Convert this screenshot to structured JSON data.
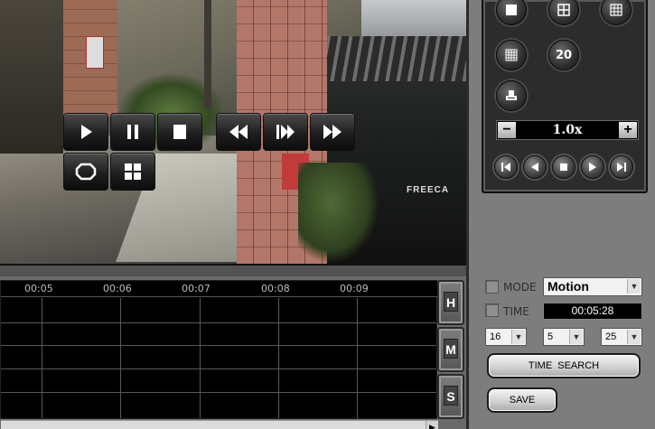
{
  "video": {
    "overlay_controls": {
      "row1": [
        "play",
        "pause",
        "stop",
        "rewind",
        "step-forward",
        "fast-forward"
      ],
      "row2": [
        "fullscreen",
        "quad-view"
      ]
    },
    "car_label": "FREECA"
  },
  "layout_panel": {
    "buttons": [
      "single-view",
      "quad-view",
      "nine-view",
      "sixteen-view",
      "twenty-view",
      "print"
    ],
    "twenty_label": "20",
    "speed": {
      "value": "1.0x",
      "minus": "−",
      "plus": "+"
    },
    "transport": [
      "previous",
      "step-back",
      "stop",
      "step-forward",
      "next"
    ]
  },
  "search_panel": {
    "mode": {
      "label": "MODE",
      "checked": false,
      "value": "Motion"
    },
    "time": {
      "label": "TIME",
      "checked": false,
      "value": "00:05:28"
    },
    "hour": "16",
    "minute": "5",
    "second": "25",
    "time_search_label": "TIME  SEARCH",
    "save_label": "SAVE"
  },
  "timeline": {
    "ticks": [
      "00:05",
      "00:06",
      "00:07",
      "00:08",
      "00:09"
    ],
    "zoom_buttons": [
      "H",
      "M",
      "S"
    ]
  }
}
